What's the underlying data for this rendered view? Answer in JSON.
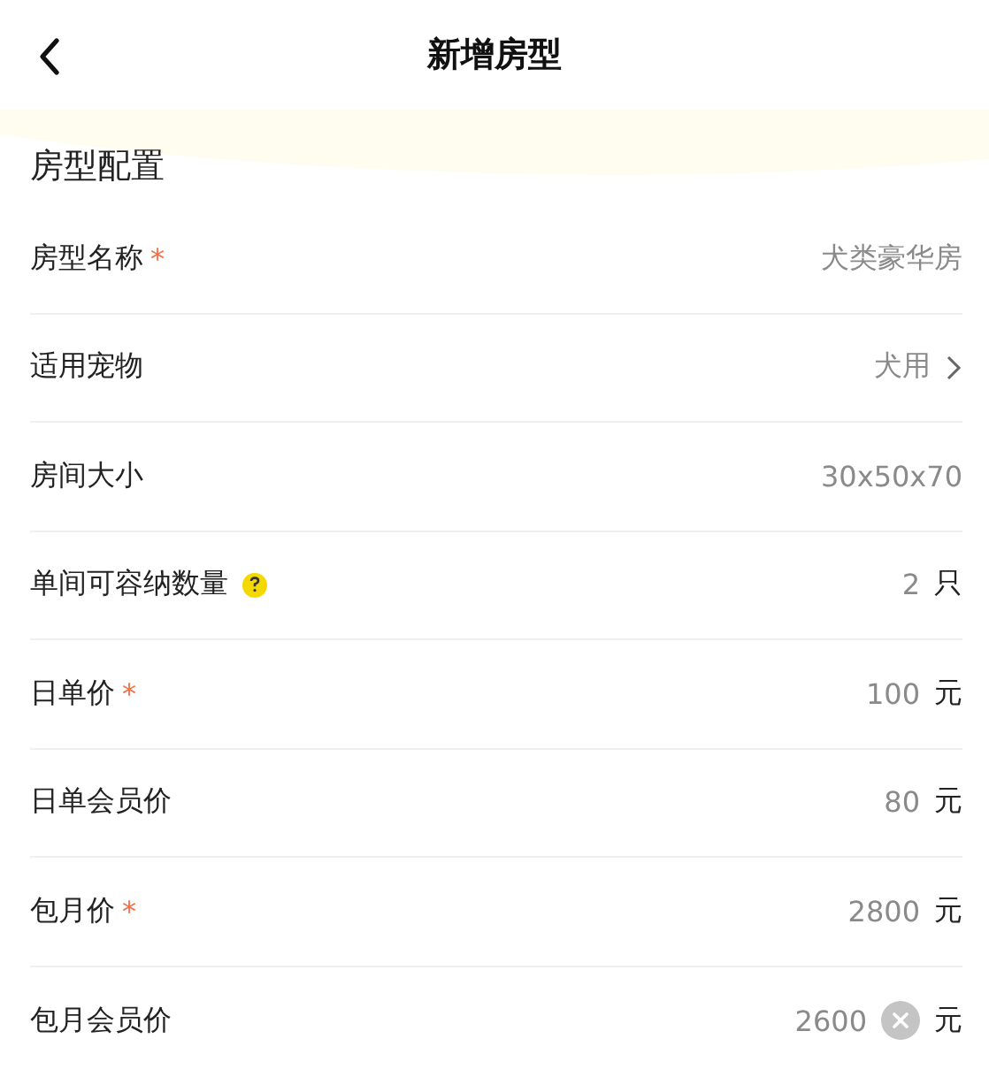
{
  "header": {
    "title": "新增房型"
  },
  "section": {
    "title": "房型配置"
  },
  "rows": [
    {
      "label": "房型名称",
      "required_mark": "*",
      "help": false,
      "kind": "input",
      "value": "犬类豪华房",
      "clear_button": false
    },
    {
      "label": "适用宠物",
      "help": false,
      "kind": "select",
      "value": "犬用",
      "clear_button": false
    },
    {
      "label": "房间大小",
      "help": false,
      "kind": "input",
      "value": "30x50x70",
      "clear_button": false
    },
    {
      "label": "单间可容纳数量",
      "help": true,
      "kind": "input",
      "value": "2",
      "unit": "只",
      "clear_button": false
    },
    {
      "label": "日单价",
      "required_mark": "*",
      "help": false,
      "kind": "input",
      "value": "100",
      "unit": "元",
      "clear_button": false
    },
    {
      "label": "日单会员价",
      "help": false,
      "kind": "input",
      "value": "80",
      "unit": "元",
      "clear_button": false
    },
    {
      "label": "包月价",
      "required_mark": "*",
      "help": false,
      "kind": "input",
      "value": "2800",
      "unit": "元",
      "clear_button": false
    },
    {
      "label": "包月会员价",
      "help": false,
      "kind": "input",
      "value": "2600",
      "unit": "元",
      "clear_button": true
    }
  ]
}
